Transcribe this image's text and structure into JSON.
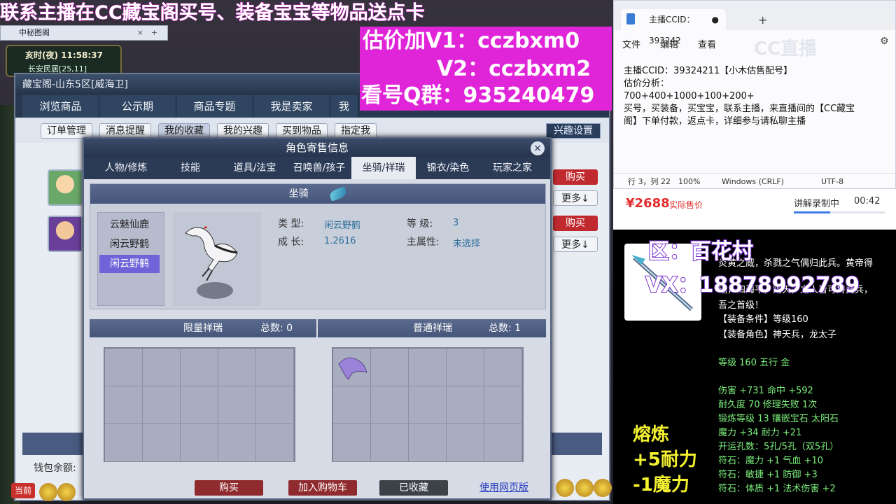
{
  "banner": "联系主播在CC藏宝阁买号、装备宝宝等物品送点卡",
  "overlay": {
    "line1": "估价加V1：cczbxm0",
    "line2": "V2：cczbxm2",
    "line3": "看号Q群：935240479"
  },
  "browser_tab": {
    "label": "中秘图阁",
    "close": "×",
    "plus": "+"
  },
  "game": {
    "time": "亥时(夜)  11:58:37",
    "location": "长安民居[25,11]",
    "wallet_label": "钱包余额:",
    "current_label": "当前"
  },
  "treasure": {
    "title": "藏宝阁-山东5区[威海卫]",
    "tabs": [
      "浏览商品",
      "公示期",
      "商品专题",
      "我是卖家",
      "我"
    ],
    "subtabs": [
      "订单管理",
      "消息提醒",
      "我的收藏",
      "我的兴趣",
      "买到物品",
      "指定我"
    ],
    "settings": "兴趣设置",
    "buy": "购买",
    "more": "更多↓"
  },
  "modal": {
    "title": "角色寄售信息",
    "close": "×",
    "tabs": [
      "人物/修炼",
      "技能",
      "道具/法宝",
      "召唤兽/孩子",
      "坐骑/祥瑞",
      "锦衣/染色",
      "玩家之家"
    ],
    "active_tab": "坐骑/祥瑞",
    "mount_header": "坐骑",
    "mount_list": [
      "云魅仙鹿",
      "闲云野鹤",
      "闲云野鹤"
    ],
    "type_label": "类  型:",
    "type_value": "闲云野鹤",
    "level_label": "等  级:",
    "level_value": "3",
    "growth_label": "成  长:",
    "growth_value": "1.2616",
    "main_attr_label": "主属性:",
    "main_attr_value": "未选择",
    "limited_title": "限量祥瑞",
    "limited_total": "总数: 0",
    "normal_title": "普通祥瑞",
    "normal_total": "总数: 1",
    "btn_buy": "购买",
    "btn_cart": "加入购物车",
    "btn_fav": "已收藏",
    "btn_web": "使用网页版"
  },
  "notepad": {
    "tab_title": "主播CCID：393242",
    "menu": [
      "文件",
      "编辑",
      "查看"
    ],
    "lines": [
      "主播CCID：39324211【小木估售配号】",
      "估价分析：",
      "700+400+1000+100+200+",
      "买号，买装备，买宝宝，联系主播，来直播间的【CC藏宝",
      "阁】下单付款，返点卡，详细参与请私聊主播"
    ],
    "status": [
      "行 3，列 22",
      "100%",
      "Windows (CRLF)",
      "UTF-8"
    ],
    "watermark": "CC直播"
  },
  "price": {
    "value": "¥2688",
    "label": "实际售价",
    "record": "讲解录制中",
    "time": "00:42"
  },
  "item": {
    "zone": "区：百花村",
    "vx": "VX：18878992789",
    "lines": [
      "炎黄之威，杀戮之气偶归此兵。黄帝得",
      "瑞，四海平，则天，之人皆可持此兵，",
      "吾之首级！",
      "【装备条件】等级160",
      "【装备角色】神天兵，龙太子",
      "",
      "等级 160 五行 金",
      "",
      "伤害 +731 命中 +592",
      "耐久度 70 修理失败 1次",
      "锻炼等级 13 镶嵌宝石 太阳石",
      "魔力 +34 耐力 +21",
      "开运孔数：5孔/5孔（双5孔）",
      "符石：魔力 +1 气血 +10",
      "符石：敏捷 +1 防御 +3",
      "符石：体质 +1 法术伤害 +2"
    ],
    "melt": "熔炼",
    "melt1": "+5耐力",
    "melt2": "-1魔力"
  }
}
